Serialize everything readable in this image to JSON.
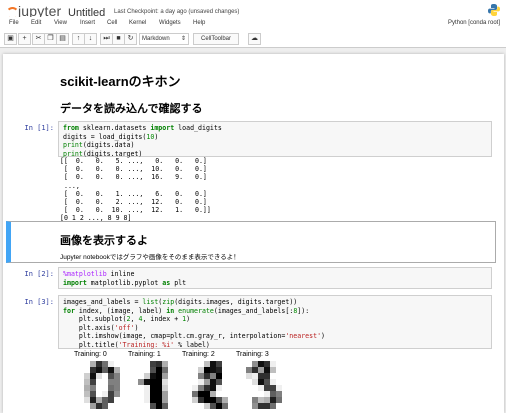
{
  "header": {
    "logo_text": "jupyter",
    "notebook_title": "Untitled",
    "checkpoint": "Last Checkpoint: a day ago (unsaved changes)"
  },
  "menubar": {
    "items": [
      "File",
      "Edit",
      "View",
      "Insert",
      "Cell",
      "Kernel",
      "Widgets",
      "Help"
    ],
    "kernel": "Python [conda root]"
  },
  "toolbar": {
    "buttons": [
      "save-icon",
      "add-icon",
      "cut-icon",
      "copy-icon",
      "paste-icon",
      "move-up-icon",
      "move-down-icon",
      "run-icon",
      "stop-icon",
      "restart-icon"
    ],
    "cell_type": "Markdown",
    "celltoolbar_label": "CellToolbar",
    "upload_icon": "upload-icon"
  },
  "notebook": {
    "h1": "scikit-learnのキホン",
    "h2_load": "データを読み込んで確認する",
    "cell1": {
      "prompt": "In [1]:",
      "lines": [
        "from sklearn.datasets import load_digits",
        "digits = load_digits(10)",
        "print(digits.data)",
        "print(digits.target)"
      ],
      "output": "[[  0.   0.   5. ...,   0.   0.   0.]\n [  0.   0.   0. ...,  10.   0.   0.]\n [  0.   0.   0. ...,  16.   9.   0.]\n ...,\n [  0.   0.   1. ...,   6.   0.   0.]\n [  0.   0.   2. ...,  12.   0.   0.]\n [  0.   0.  10. ...,  12.   1.   0.]]\n[0 1 2 ..., 8 9 8]"
    },
    "h2_show": "画像を表示するよ",
    "md_text": "Jupyter notebookではグラフや画像をそのまま表示できるよ！",
    "cell2": {
      "prompt": "In [2]:",
      "lines": [
        "%matplotlib inline",
        "import matplotlib.pyplot as plt"
      ]
    },
    "cell3": {
      "prompt": "In [3]:",
      "lines": [
        "images_and_labels = list(zip(digits.images, digits.target))",
        "for index, (image, label) in enumerate(images_and_labels[:8]):",
        "    plt.subplot(2, 4, index + 1)",
        "    plt.axis('off')",
        "    plt.imshow(image, cmap=plt.cm.gray_r, interpolation='nearest')",
        "    plt.title('Training: %i' % label)"
      ]
    },
    "digit_titles": [
      "Training: 0",
      "Training: 1",
      "Training: 2",
      "Training: 3"
    ],
    "digit_images": [
      [
        [
          0,
          0,
          5,
          13,
          9,
          1,
          0,
          0
        ],
        [
          0,
          0,
          13,
          15,
          10,
          15,
          5,
          0
        ],
        [
          0,
          3,
          15,
          2,
          0,
          11,
          8,
          0
        ],
        [
          0,
          4,
          12,
          0,
          0,
          8,
          8,
          0
        ],
        [
          0,
          5,
          8,
          0,
          0,
          9,
          8,
          0
        ],
        [
          0,
          4,
          11,
          0,
          1,
          12,
          7,
          0
        ],
        [
          0,
          2,
          14,
          5,
          10,
          12,
          0,
          0
        ],
        [
          0,
          0,
          6,
          13,
          10,
          0,
          0,
          0
        ]
      ],
      [
        [
          0,
          0,
          0,
          12,
          13,
          5,
          0,
          0
        ],
        [
          0,
          0,
          0,
          11,
          16,
          9,
          0,
          0
        ],
        [
          0,
          0,
          3,
          15,
          16,
          6,
          0,
          0
        ],
        [
          0,
          7,
          15,
          16,
          16,
          2,
          0,
          0
        ],
        [
          0,
          0,
          1,
          16,
          16,
          3,
          0,
          0
        ],
        [
          0,
          0,
          1,
          16,
          16,
          6,
          0,
          0
        ],
        [
          0,
          0,
          1,
          16,
          16,
          6,
          0,
          0
        ],
        [
          0,
          0,
          0,
          11,
          16,
          10,
          0,
          0
        ]
      ],
      [
        [
          0,
          0,
          0,
          4,
          15,
          12,
          0,
          0
        ],
        [
          0,
          0,
          3,
          16,
          15,
          14,
          0,
          0
        ],
        [
          0,
          0,
          8,
          13,
          8,
          16,
          0,
          0
        ],
        [
          0,
          0,
          1,
          6,
          15,
          11,
          0,
          0
        ],
        [
          0,
          1,
          8,
          13,
          15,
          1,
          0,
          0
        ],
        [
          0,
          9,
          16,
          16,
          5,
          0,
          0,
          0
        ],
        [
          0,
          3,
          13,
          16,
          16,
          11,
          5,
          0
        ],
        [
          0,
          0,
          0,
          3,
          11,
          16,
          9,
          0
        ]
      ],
      [
        [
          0,
          0,
          7,
          15,
          13,
          1,
          0,
          0
        ],
        [
          0,
          8,
          13,
          6,
          15,
          4,
          0,
          0
        ],
        [
          0,
          2,
          1,
          13,
          13,
          0,
          0,
          0
        ],
        [
          0,
          0,
          2,
          15,
          11,
          1,
          0,
          0
        ],
        [
          0,
          0,
          0,
          1,
          12,
          12,
          1,
          0
        ],
        [
          0,
          0,
          0,
          0,
          1,
          10,
          8,
          0
        ],
        [
          0,
          0,
          8,
          4,
          5,
          14,
          9,
          0
        ],
        [
          0,
          0,
          7,
          13,
          13,
          9,
          0,
          0
        ]
      ]
    ]
  },
  "colors": {
    "accent_selected": "#42a5f5",
    "prompt": "#303f9f",
    "logo_orange": "#f37626"
  }
}
